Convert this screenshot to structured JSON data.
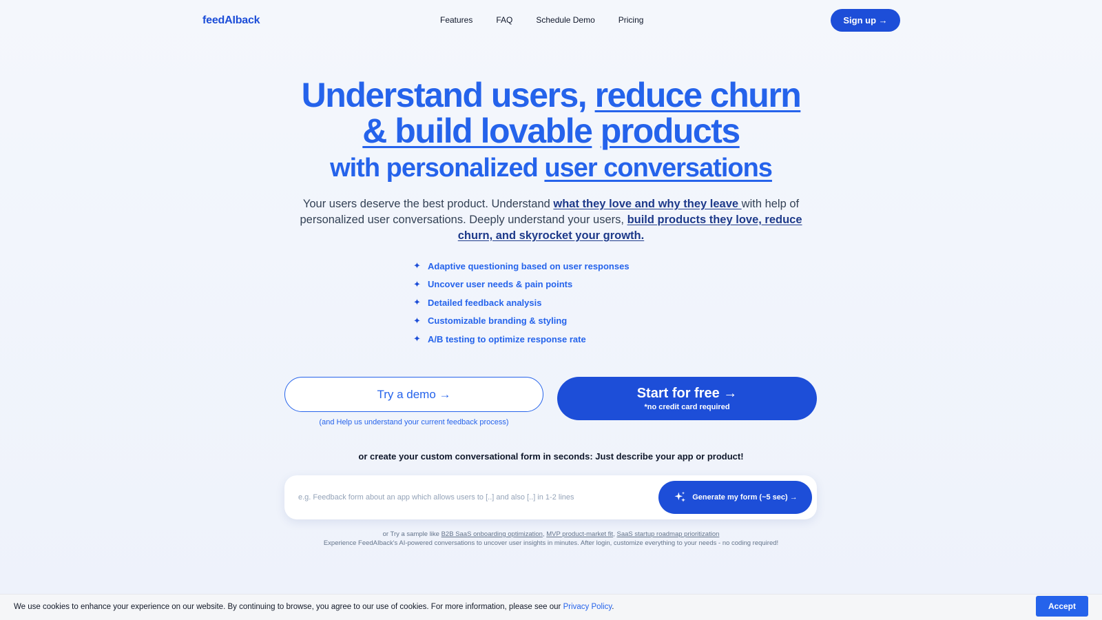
{
  "nav": {
    "logo": "feedAIback",
    "links": [
      "Features",
      "FAQ",
      "Schedule Demo",
      "Pricing"
    ],
    "signup_label": "Sign up →"
  },
  "hero": {
    "line1_plain": "Understand users, ",
    "line1_underlined": "reduce churn",
    "line2_underlined_a": "& build lovable",
    "line2_underlined_b": "products",
    "line3_plain": "with personalized ",
    "line3_underlined": "user conversations"
  },
  "subtitle": {
    "part1": "Your users deserve the best product. Understand ",
    "bold1": "what they love and why they leave ",
    "part2": "with help of personalized user conversations. Deeply understand your users, ",
    "bold2": "build products they love, reduce churn, and skyrocket your growth."
  },
  "features": [
    "Adaptive questioning based on user responses",
    "Uncover user needs & pain points",
    "Detailed feedback analysis",
    "Customizable branding & styling",
    "A/B testing to optimize response rate"
  ],
  "cta": {
    "demo_label": "Try a demo →",
    "demo_note": "(and Help us understand your current feedback process)",
    "start_label": "Start for free →",
    "start_note": "*no credit card required"
  },
  "generator": {
    "heading": "or create your custom conversational form in seconds: Just describe your app or product!",
    "placeholder": "e.g. Feedback form about an app which allows users to [..] and also [..] in 1-2 lines",
    "button_label": "Generate my form (~5 sec) →"
  },
  "samples": {
    "prefix": "or Try a sample like ",
    "links": [
      "B2B SaaS onboarding optimization",
      "MVP product-market fit",
      "SaaS startup roadmap prioritization"
    ],
    "sep": ", ",
    "note": "Experience FeedAIback's AI-powered conversations to uncover user insights in minutes. After login, customize everything to your needs - no coding required!"
  },
  "cookie": {
    "message": "We use cookies to enhance your experience on our website. By continuing to browse, you agree to our use of cookies. For more information, please see our ",
    "link": "Privacy Policy",
    "period": ".",
    "accept_label": "Accept"
  },
  "colors": {
    "brand": "#1d4ed8",
    "accent": "#2563eb",
    "heading_dark": "#1e3a8a"
  },
  "icons": {
    "feature_bullet": "sparkle-icon",
    "generate": "sparkles-icon"
  }
}
